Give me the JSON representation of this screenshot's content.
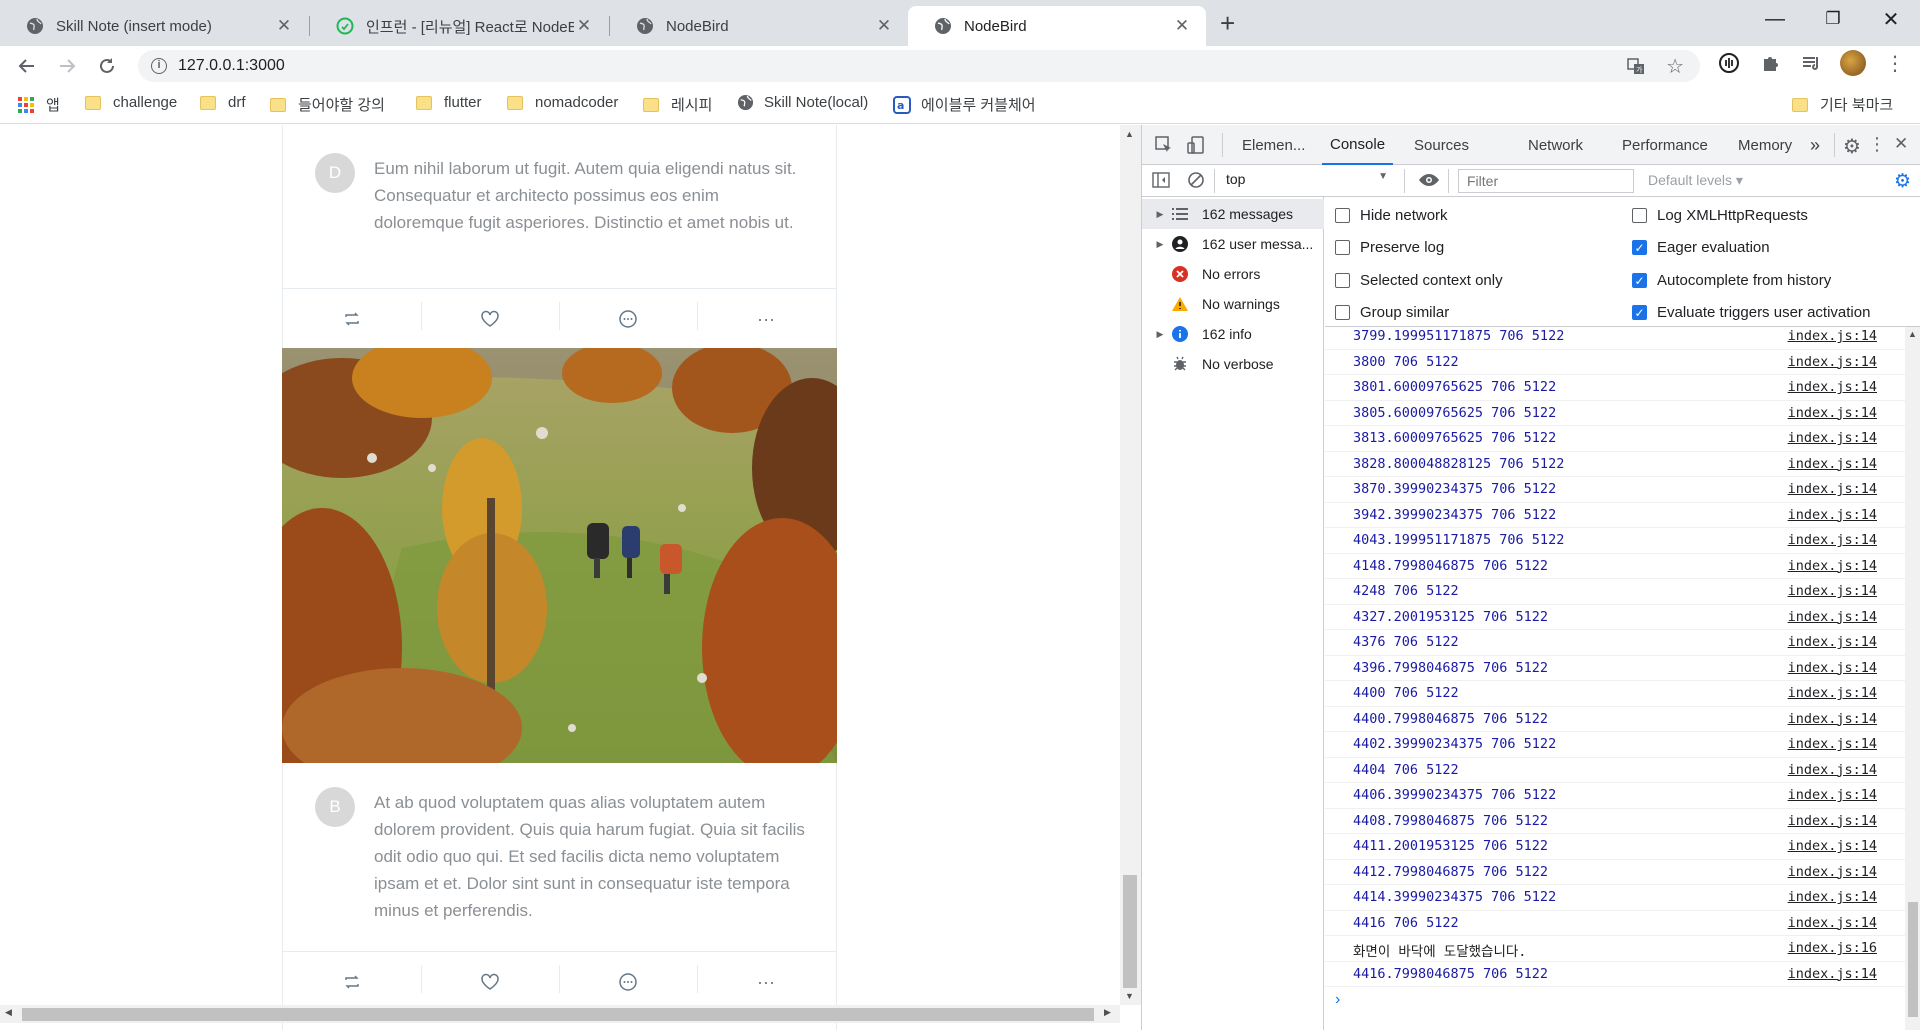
{
  "tabs": [
    {
      "title": "Skill Note (insert mode)",
      "active": false
    },
    {
      "title": "인프런 - [리뉴얼] React로 NodeBird",
      "active": false
    },
    {
      "title": "NodeBird",
      "active": false
    },
    {
      "title": "NodeBird",
      "active": true
    }
  ],
  "new_tab": "+",
  "window_controls": {
    "minimize": "—",
    "maximize": "❐",
    "close": "✕"
  },
  "address": {
    "url": "127.0.0.1:3000"
  },
  "bookmarks": [
    {
      "label": "앱",
      "icon": "apps-grid-icon"
    },
    {
      "label": "challenge",
      "icon": "folder-icon"
    },
    {
      "label": "drf",
      "icon": "folder-icon"
    },
    {
      "label": "들어야할 강의",
      "icon": "folder-icon"
    },
    {
      "label": "flutter",
      "icon": "folder-icon"
    },
    {
      "label": "nomadcoder",
      "icon": "folder-icon"
    },
    {
      "label": "레시피",
      "icon": "folder-icon"
    },
    {
      "label": "Skill Note(local)",
      "icon": "globe-icon"
    },
    {
      "label": "에이블루 커블체어",
      "icon": "ablue-icon"
    }
  ],
  "other_bookmarks": "기타 북마크",
  "posts": [
    {
      "avatar": "D",
      "text": "Eum nihil laborum ut fugit. Autem quia eligendi natus sit. Consequatur et architecto possimus eos enim doloremque fugit asperiores. Distinctio et amet nobis ut."
    },
    {
      "avatar": "B",
      "text": "At ab quod voluptatem quas alias voluptatem autem dolorem provident. Quis quia harum fugiat. Quia sit facilis odit odio quo qui. Et sed facilis dicta nemo voluptatem ipsam et et. Dolor sint sunt in consequatur iste tempora minus et perferendis."
    }
  ],
  "post_actions": [
    "retweet-icon",
    "heart-icon",
    "message-icon",
    "ellipsis-icon"
  ],
  "ellipsis": "···",
  "devtools": {
    "tabs": [
      "Elemen...",
      "Console",
      "Sources",
      "Network",
      "Performance",
      "Memory"
    ],
    "more": "»",
    "context": "top",
    "filter_placeholder": "Filter",
    "levels": "Default levels ▾",
    "sidebar": [
      {
        "label": "162 messages",
        "icon": "list-icon",
        "expandable": true,
        "selected": true
      },
      {
        "label": "162 user messa...",
        "icon": "user-icon",
        "expandable": true,
        "selected": false
      },
      {
        "label": "No errors",
        "icon": "error-icon",
        "expandable": false,
        "selected": false
      },
      {
        "label": "No warnings",
        "icon": "warning-icon",
        "expandable": false,
        "selected": false
      },
      {
        "label": "162 info",
        "icon": "info-icon",
        "expandable": true,
        "selected": false
      },
      {
        "label": "No verbose",
        "icon": "bug-icon",
        "expandable": false,
        "selected": false
      }
    ],
    "settings_left": [
      {
        "label": "Hide network",
        "checked": false
      },
      {
        "label": "Preserve log",
        "checked": false
      },
      {
        "label": "Selected context only",
        "checked": false
      },
      {
        "label": "Group similar",
        "checked": false
      }
    ],
    "settings_right": [
      {
        "label": "Log XMLHttpRequests",
        "checked": false
      },
      {
        "label": "Eager evaluation",
        "checked": true
      },
      {
        "label": "Autocomplete from history",
        "checked": true
      },
      {
        "label": "Evaluate triggers user activation",
        "checked": true
      }
    ],
    "logs": [
      {
        "msg": "3799.199951171875 706 5122",
        "src": "index.js:14"
      },
      {
        "msg": "3800 706 5122",
        "src": "index.js:14"
      },
      {
        "msg": "3801.60009765625 706 5122",
        "src": "index.js:14"
      },
      {
        "msg": "3805.60009765625 706 5122",
        "src": "index.js:14"
      },
      {
        "msg": "3813.60009765625 706 5122",
        "src": "index.js:14"
      },
      {
        "msg": "3828.800048828125 706 5122",
        "src": "index.js:14"
      },
      {
        "msg": "3870.39990234375 706 5122",
        "src": "index.js:14"
      },
      {
        "msg": "3942.39990234375 706 5122",
        "src": "index.js:14"
      },
      {
        "msg": "4043.199951171875 706 5122",
        "src": "index.js:14"
      },
      {
        "msg": "4148.7998046875 706 5122",
        "src": "index.js:14"
      },
      {
        "msg": "4248 706 5122",
        "src": "index.js:14"
      },
      {
        "msg": "4327.2001953125 706 5122",
        "src": "index.js:14"
      },
      {
        "msg": "4376 706 5122",
        "src": "index.js:14"
      },
      {
        "msg": "4396.7998046875 706 5122",
        "src": "index.js:14"
      },
      {
        "msg": "4400 706 5122",
        "src": "index.js:14"
      },
      {
        "msg": "4400.7998046875 706 5122",
        "src": "index.js:14"
      },
      {
        "msg": "4402.39990234375 706 5122",
        "src": "index.js:14"
      },
      {
        "msg": "4404 706 5122",
        "src": "index.js:14"
      },
      {
        "msg": "4406.39990234375 706 5122",
        "src": "index.js:14"
      },
      {
        "msg": "4408.7998046875 706 5122",
        "src": "index.js:14"
      },
      {
        "msg": "4411.2001953125 706 5122",
        "src": "index.js:14"
      },
      {
        "msg": "4412.7998046875 706 5122",
        "src": "index.js:14"
      },
      {
        "msg": "4414.39990234375 706 5122",
        "src": "index.js:14"
      },
      {
        "msg": "4416 706 5122",
        "src": "index.js:14"
      },
      {
        "msg": "화면이 바닥에 도달했습니다.",
        "src": "index.js:16",
        "plain": true
      },
      {
        "msg": "4416.7998046875 706 5122",
        "src": "index.js:14"
      }
    ],
    "prompt": "›"
  }
}
